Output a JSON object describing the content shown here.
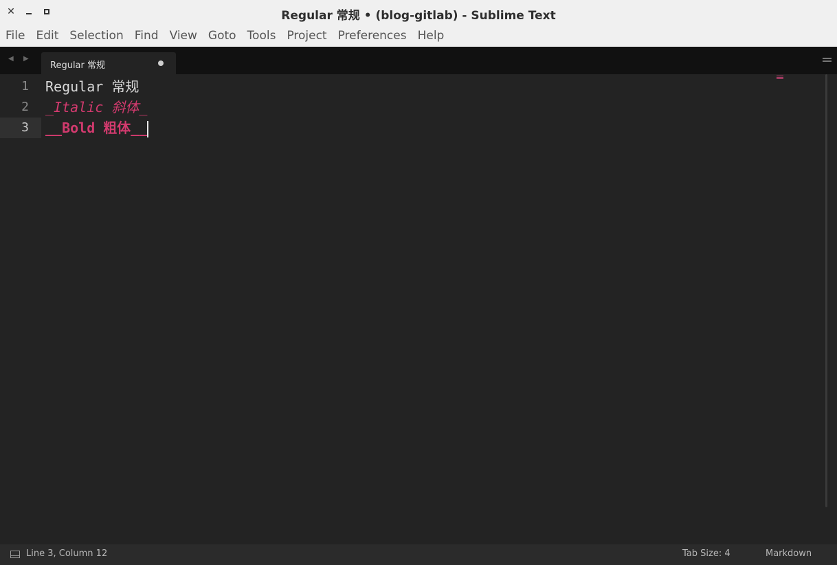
{
  "window": {
    "title": "Regular 常规 • (blog-gitlab) - Sublime Text",
    "close_glyph": "✕"
  },
  "menu": [
    "File",
    "Edit",
    "Selection",
    "Find",
    "View",
    "Goto",
    "Tools",
    "Project",
    "Preferences",
    "Help"
  ],
  "tabs": {
    "left_arrow": "◀",
    "right_arrow": "▶",
    "active": {
      "label": "Regular 常规",
      "modified": true
    }
  },
  "editor": {
    "lines": [
      {
        "number": "1",
        "text": "Regular 常规",
        "style": "regular"
      },
      {
        "number": "2",
        "text": "_Italic 斜体_",
        "style": "italic"
      },
      {
        "number": "3",
        "text": "__Bold 粗体__",
        "style": "bold"
      }
    ],
    "current_line": 3,
    "colors": {
      "background": "#232323",
      "text": "#d8d8d8",
      "markup_accent": "#d23a6e",
      "line_numbers": "#8a8a8a"
    }
  },
  "status": {
    "position": "Line 3, Column 12",
    "tab_size": "Tab Size: 4",
    "syntax": "Markdown"
  }
}
